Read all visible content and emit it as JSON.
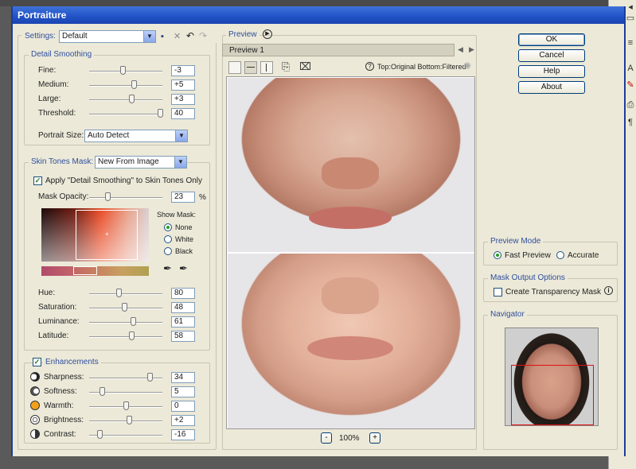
{
  "window": {
    "title": "Portraiture"
  },
  "settings": {
    "label": "Settings:",
    "preset": "Default"
  },
  "detail_smoothing": {
    "title": "Detail Smoothing",
    "sliders": [
      {
        "label": "Fine:",
        "value": "-3",
        "level": 0.45
      },
      {
        "label": "Medium:",
        "value": "+5",
        "level": 0.62
      },
      {
        "label": "Large:",
        "value": "+3",
        "level": 0.58
      },
      {
        "label": "Threshold:",
        "value": "40",
        "level": 1.0
      }
    ],
    "portrait_size_label": "Portrait Size:",
    "portrait_size_value": "Auto Detect"
  },
  "skin_tones": {
    "title": "Skin Tones Mask:",
    "mode": "New From Image",
    "apply_label": "Apply \"Detail Smoothing\" to Skin Tones Only",
    "opacity_label": "Mask Opacity:",
    "opacity_value": "23",
    "opacity_unit": "%",
    "opacity_level": 0.23,
    "show_mask_label": "Show Mask:",
    "show_mask_options": [
      "None",
      "White",
      "Black"
    ],
    "show_mask_selected": "None",
    "sliders": [
      {
        "label": "Hue:",
        "value": "80",
        "level": 0.4
      },
      {
        "label": "Saturation:",
        "value": "48",
        "level": 0.48
      },
      {
        "label": "Luminance:",
        "value": "61",
        "level": 0.61
      },
      {
        "label": "Latitude:",
        "value": "58",
        "level": 0.58
      }
    ]
  },
  "enhancements": {
    "title": "Enhancements",
    "sliders": [
      {
        "label": "Sharpness:",
        "value": "34",
        "level": 0.85,
        "icon": "sharpness-icon"
      },
      {
        "label": "Softness:",
        "value": "5",
        "level": 0.15,
        "icon": "softness-icon"
      },
      {
        "label": "Warmth:",
        "value": "0",
        "level": 0.5,
        "icon": "warmth-icon"
      },
      {
        "label": "Brightness:",
        "value": "+2",
        "level": 0.55,
        "icon": "brightness-icon"
      },
      {
        "label": "Contrast:",
        "value": "-16",
        "level": 0.12,
        "icon": "contrast-icon"
      }
    ]
  },
  "preview": {
    "title": "Preview",
    "tab": "Preview 1",
    "compare_label": "Top:Original Bottom:Filtered",
    "zoom": "100%",
    "zoom_out": "-",
    "zoom_in": "+"
  },
  "buttons": {
    "ok": "OK",
    "cancel": "Cancel",
    "help": "Help",
    "about": "About"
  },
  "preview_mode": {
    "title": "Preview Mode",
    "options": [
      "Fast Preview",
      "Accurate"
    ],
    "selected": "Fast Preview"
  },
  "mask_output": {
    "title": "Mask Output Options",
    "create_label": "Create Transparency Mask"
  },
  "navigator": {
    "title": "Navigator"
  },
  "colors": {
    "title_bar": "#2254c8",
    "group_title": "#2f4f9e",
    "window_bg": "#ece9d8",
    "nav_rect": "#e01010"
  }
}
